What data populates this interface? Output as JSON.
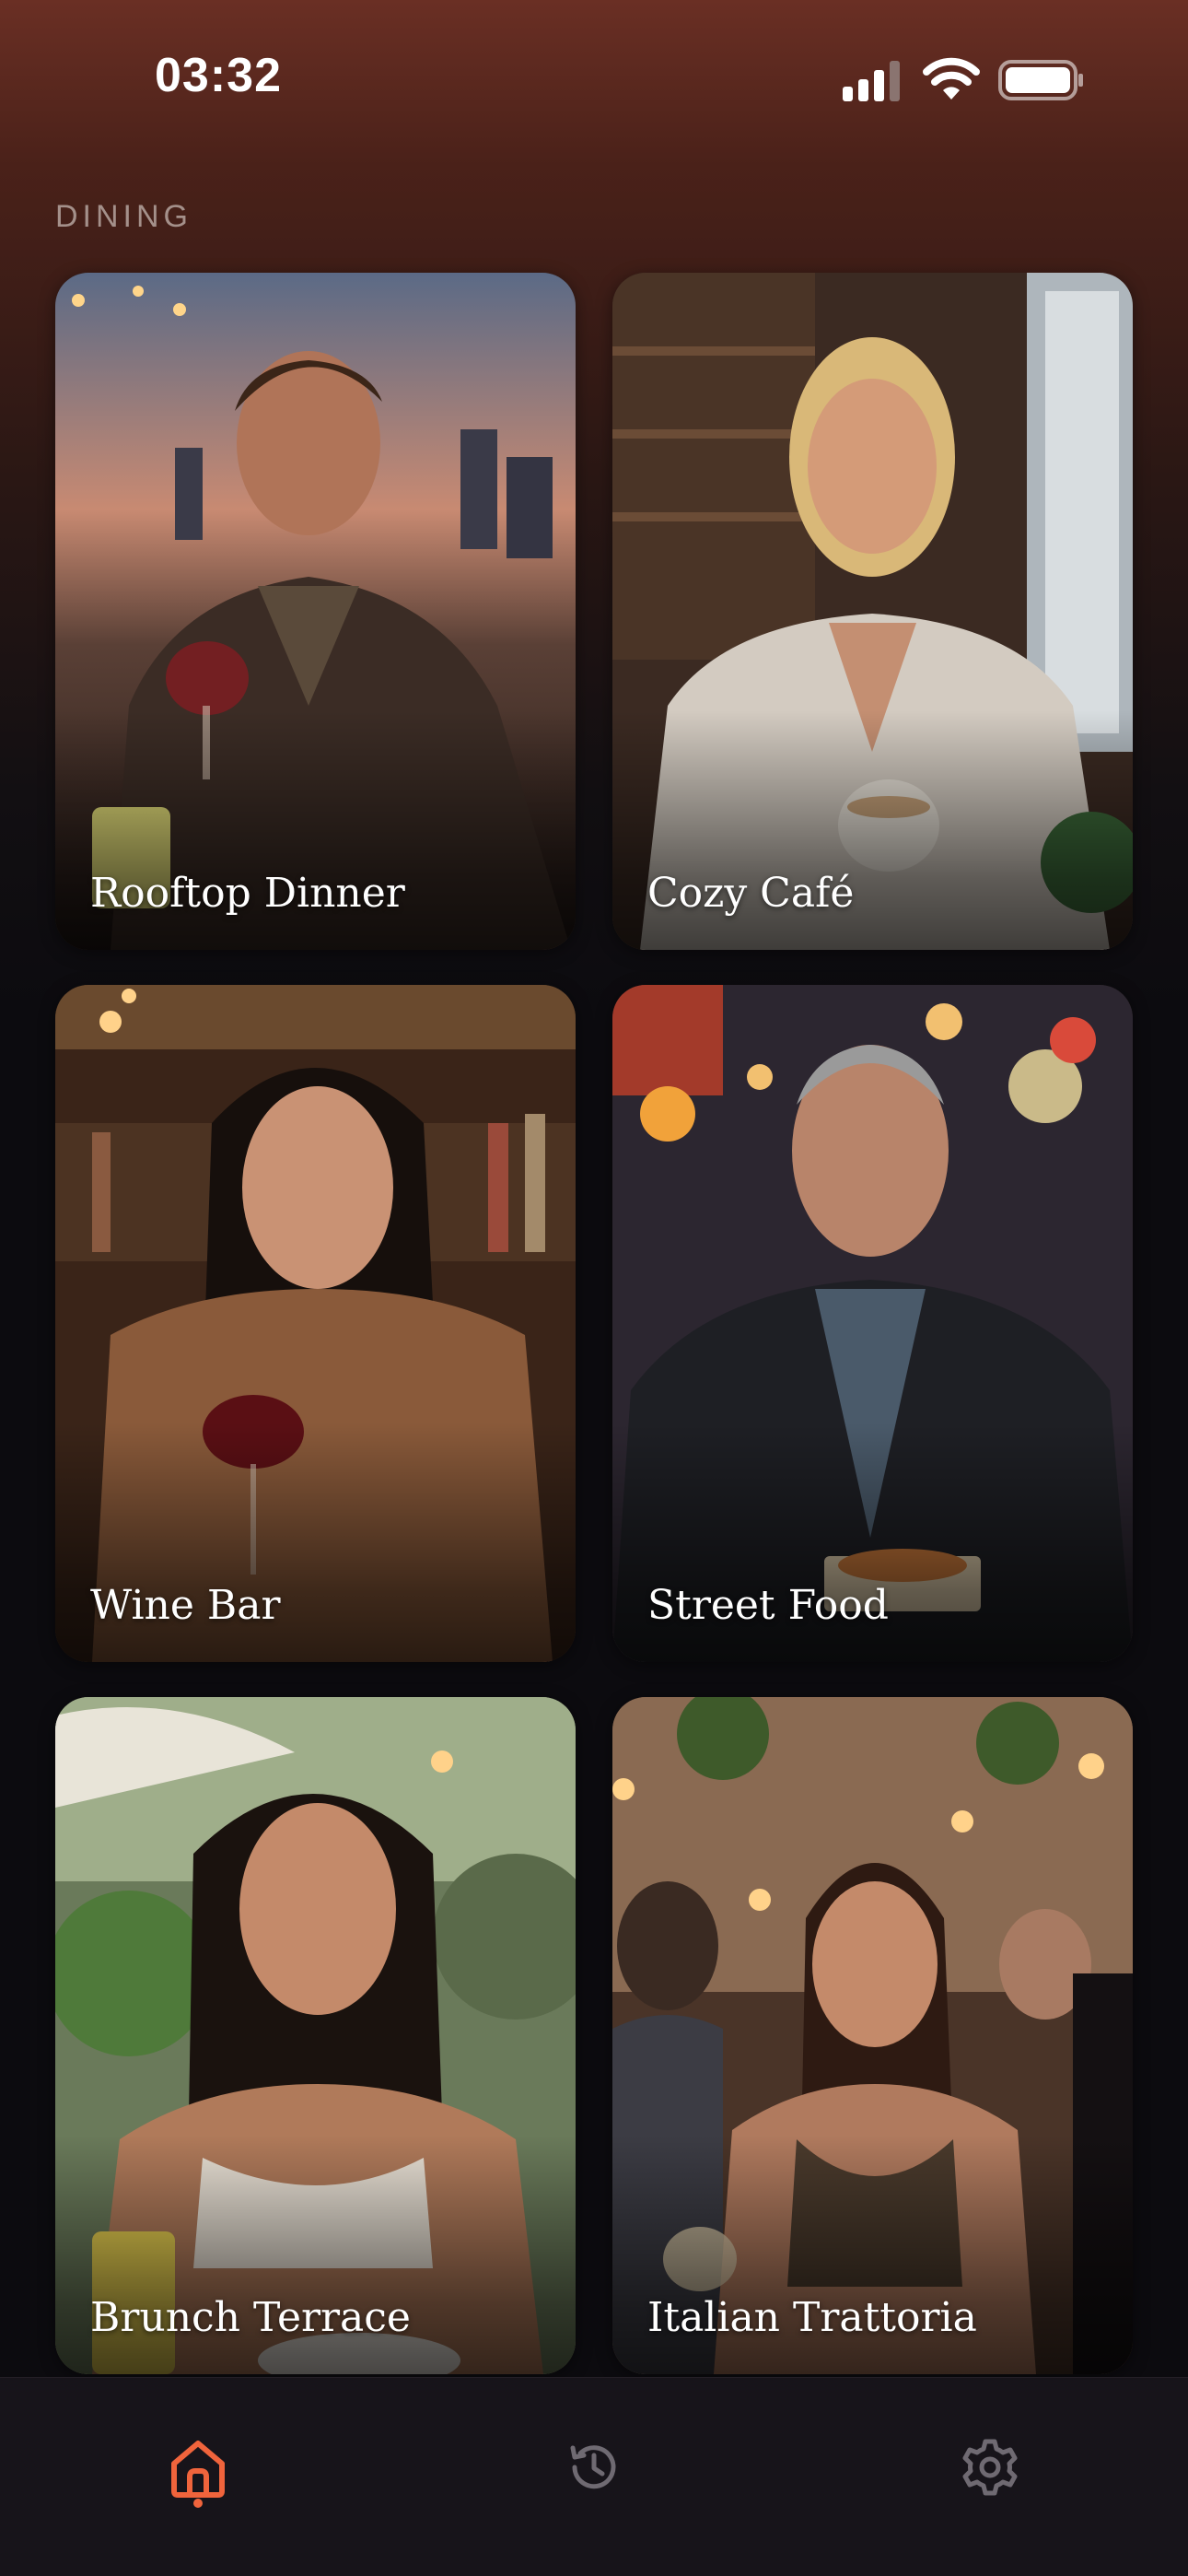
{
  "status_bar": {
    "time": "03:32"
  },
  "section": {
    "label": "DINING"
  },
  "cards": [
    {
      "title": "Rooftop Dinner"
    },
    {
      "title": "Cozy Café"
    },
    {
      "title": "Wine Bar"
    },
    {
      "title": "Street Food"
    },
    {
      "title": "Brunch Terrace"
    },
    {
      "title": "Italian Trattoria"
    }
  ],
  "tab_bar": {
    "tabs": [
      {
        "icon": "home-icon",
        "active": true
      },
      {
        "icon": "history-icon",
        "active": false
      },
      {
        "icon": "gear-icon",
        "active": false
      }
    ],
    "active_color": "#f0643c",
    "inactive_color": "#6f6a72"
  }
}
